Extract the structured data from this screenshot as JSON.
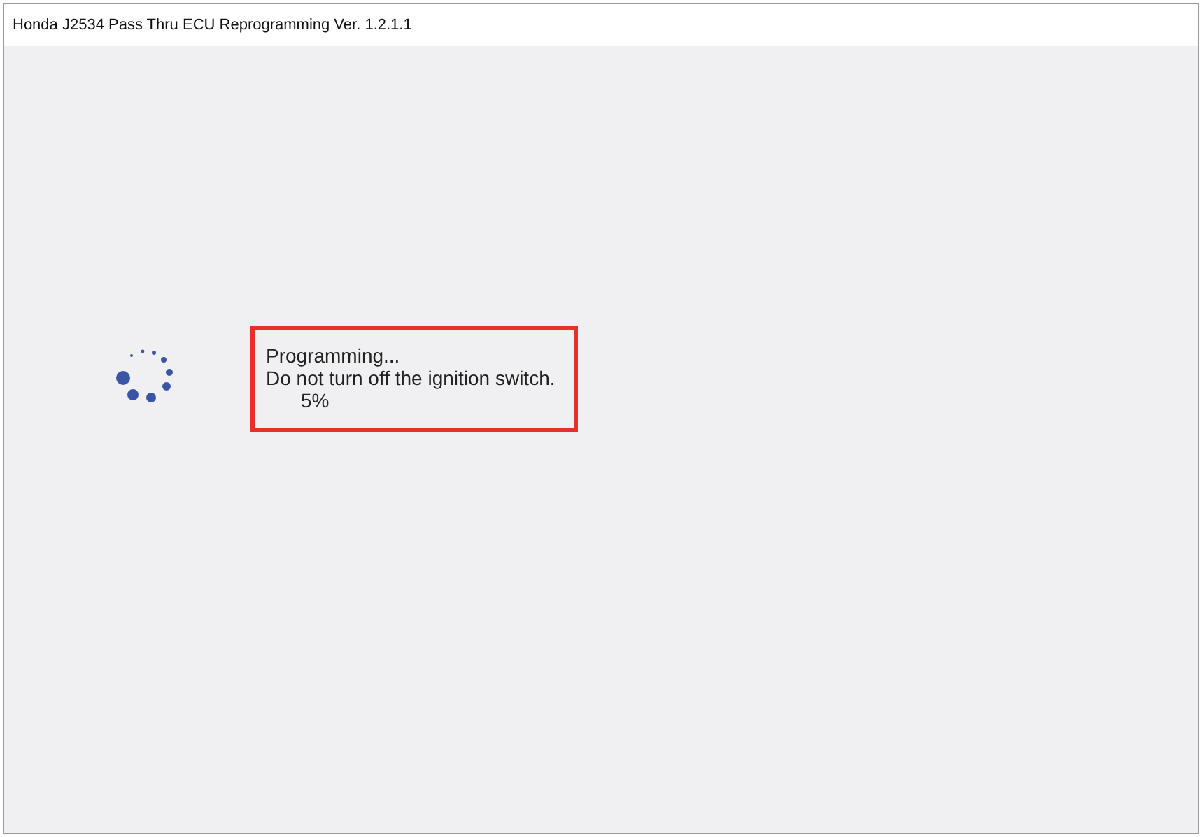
{
  "window": {
    "title": "Honda J2534 Pass Thru ECU Reprogramming Ver. 1.2.1.1"
  },
  "status": {
    "lines": [
      "Programming...",
      "Do not turn off the ignition switch."
    ],
    "percent": "5%"
  }
}
